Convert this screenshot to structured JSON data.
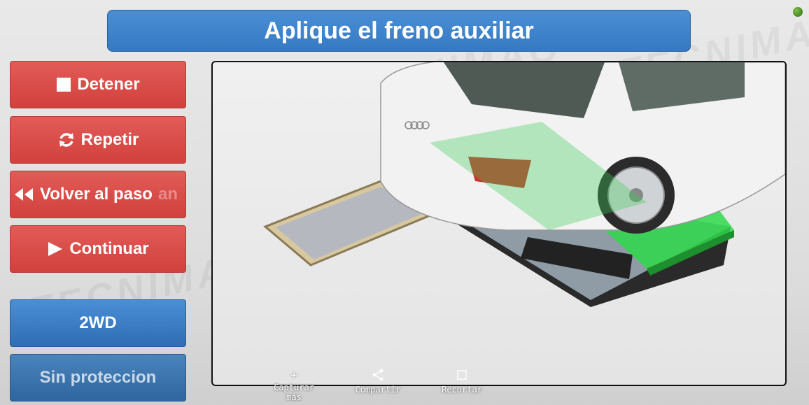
{
  "title": "Aplique el freno auxiliar",
  "sidebar": {
    "stop_label": "Detener",
    "repeat_label": "Repetir",
    "back_label": "Volver al paso",
    "back_label_overflow": "an",
    "continue_label": "Continuar",
    "drive_label": "2WD",
    "protection_label": "Sin proteccion"
  },
  "toolbar": {
    "capture_label": "Capturar",
    "capture_label_cont": "más",
    "share_label": "Compartir",
    "crop_label": "Recortar"
  },
  "watermark": "TECNIMAQ",
  "icons": {
    "stop": "stop-icon",
    "repeat": "refresh-icon",
    "back": "rewind-icon",
    "continue": "play-icon",
    "capture": "plus-icon",
    "share": "share-icon",
    "crop": "crop-icon"
  },
  "colors": {
    "accent_blue": "#3a80c9",
    "button_red": "#d9504c",
    "status_green": "#4e8f2a",
    "highlight_green": "#27c93f"
  }
}
